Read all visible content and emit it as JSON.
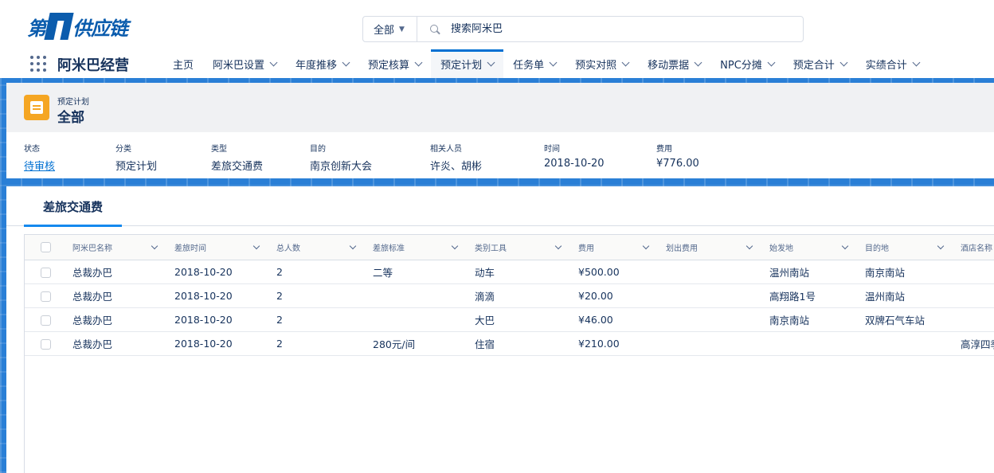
{
  "brand": {
    "logo_left": "第",
    "logo_right": "供应链"
  },
  "search": {
    "scope": "全部",
    "placeholder": "搜索阿米巴",
    "icon": "search-icon"
  },
  "app": {
    "name": "阿米巴经营",
    "launcher_icon": "app-launcher-icon"
  },
  "nav": {
    "items": [
      {
        "label": "主页",
        "dropdown": false,
        "active": false
      },
      {
        "label": "阿米巴设置",
        "dropdown": true,
        "active": false
      },
      {
        "label": "年度推移",
        "dropdown": true,
        "active": false
      },
      {
        "label": "预定核算",
        "dropdown": true,
        "active": false
      },
      {
        "label": "预定计划",
        "dropdown": true,
        "active": true
      },
      {
        "label": "任务单",
        "dropdown": true,
        "active": false
      },
      {
        "label": "预实对照",
        "dropdown": true,
        "active": false
      },
      {
        "label": "移动票据",
        "dropdown": true,
        "active": false
      },
      {
        "label": "NPC分摊",
        "dropdown": true,
        "active": false
      },
      {
        "label": "预定合计",
        "dropdown": true,
        "active": false
      },
      {
        "label": "实绩合计",
        "dropdown": true,
        "active": false
      }
    ],
    "accent_color": "#0070d2"
  },
  "record": {
    "object_type": "预定计划",
    "title": "全部",
    "icon_color": "#f5a623",
    "fields": [
      {
        "label": "状态",
        "value": "待审核",
        "link": true
      },
      {
        "label": "分类",
        "value": "预定计划",
        "link": false
      },
      {
        "label": "类型",
        "value": "差旅交通费",
        "link": false
      },
      {
        "label": "目的",
        "value": "南京创新大会",
        "link": false
      },
      {
        "label": "相关人员",
        "value": "许炎、胡彬",
        "link": false
      },
      {
        "label": "时间",
        "value": "2018-10-20",
        "link": false
      },
      {
        "label": "费用",
        "value": "¥776.00",
        "link": false
      }
    ]
  },
  "related": {
    "tab": "差旅交通费",
    "columns": [
      "阿米巴名称",
      "差旅时间",
      "总人数",
      "差旅标准",
      "类别工具",
      "费用",
      "划出费用",
      "始发地",
      "目的地",
      "酒店名称"
    ],
    "rows": [
      [
        "总裁办巴",
        "2018-10-20",
        "2",
        "二等",
        "动车",
        "¥500.00",
        "",
        "温州南站",
        "南京南站",
        ""
      ],
      [
        "总裁办巴",
        "2018-10-20",
        "2",
        "",
        "滴滴",
        "¥20.00",
        "",
        "高翔路1号",
        "温州南站",
        ""
      ],
      [
        "总裁办巴",
        "2018-10-20",
        "2",
        "",
        "大巴",
        "¥46.00",
        "",
        "南京南站",
        "双牌石气车站",
        ""
      ],
      [
        "总裁办巴",
        "2018-10-20",
        "2",
        "280元/间",
        "住宿",
        "¥210.00",
        "",
        "",
        "",
        "高淳四季"
      ]
    ]
  }
}
